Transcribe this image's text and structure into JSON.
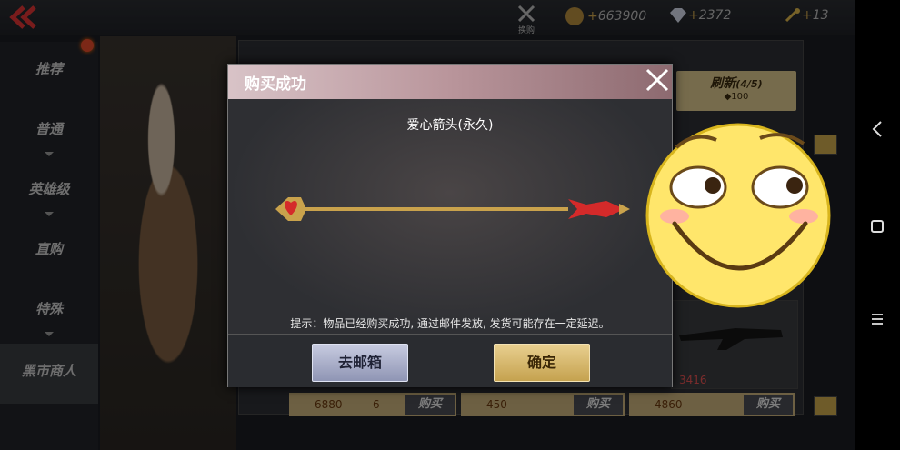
{
  "topbar": {
    "exchange_label": "换购",
    "coins": "663900",
    "diamonds": "2372",
    "tokens": "13",
    "colors": {
      "coin": "#b38a3c",
      "diamond": "#cfd6e6",
      "token": "#d9b24a",
      "wifi": "#2fae3a"
    }
  },
  "menu": {
    "items": [
      {
        "label": "推荐"
      },
      {
        "label": "普通"
      },
      {
        "label": "英雄级"
      },
      {
        "label": "直购"
      },
      {
        "label": "特殊"
      },
      {
        "label": "黑市商人"
      }
    ]
  },
  "shop": {
    "refresh_label": "刷新",
    "refresh_count": "(4/5)",
    "refresh_cost": "100",
    "price_b": "3416",
    "card1_price": "6880",
    "card1_token": "6",
    "card2_price": "450",
    "card3_price": "4860",
    "buy_label": "购买"
  },
  "dialog": {
    "title": "购买成功",
    "item_name": "爱心箭头(永久)",
    "hint": "提示：物品已经购买成功, 通过邮件发放, 发货可能存在一定延迟。",
    "mailbox_button": "去邮箱",
    "ok_button": "确定",
    "colors": {
      "header": "#c9aab0",
      "ok": "#d6b564",
      "mail": "#aeb3cc",
      "arrow_heart": "#d42a2a"
    }
  },
  "navbar": {
    "back_icon": "chevron-left-icon",
    "home_icon": "square-icon",
    "menu_icon": "hamburger-icon"
  }
}
